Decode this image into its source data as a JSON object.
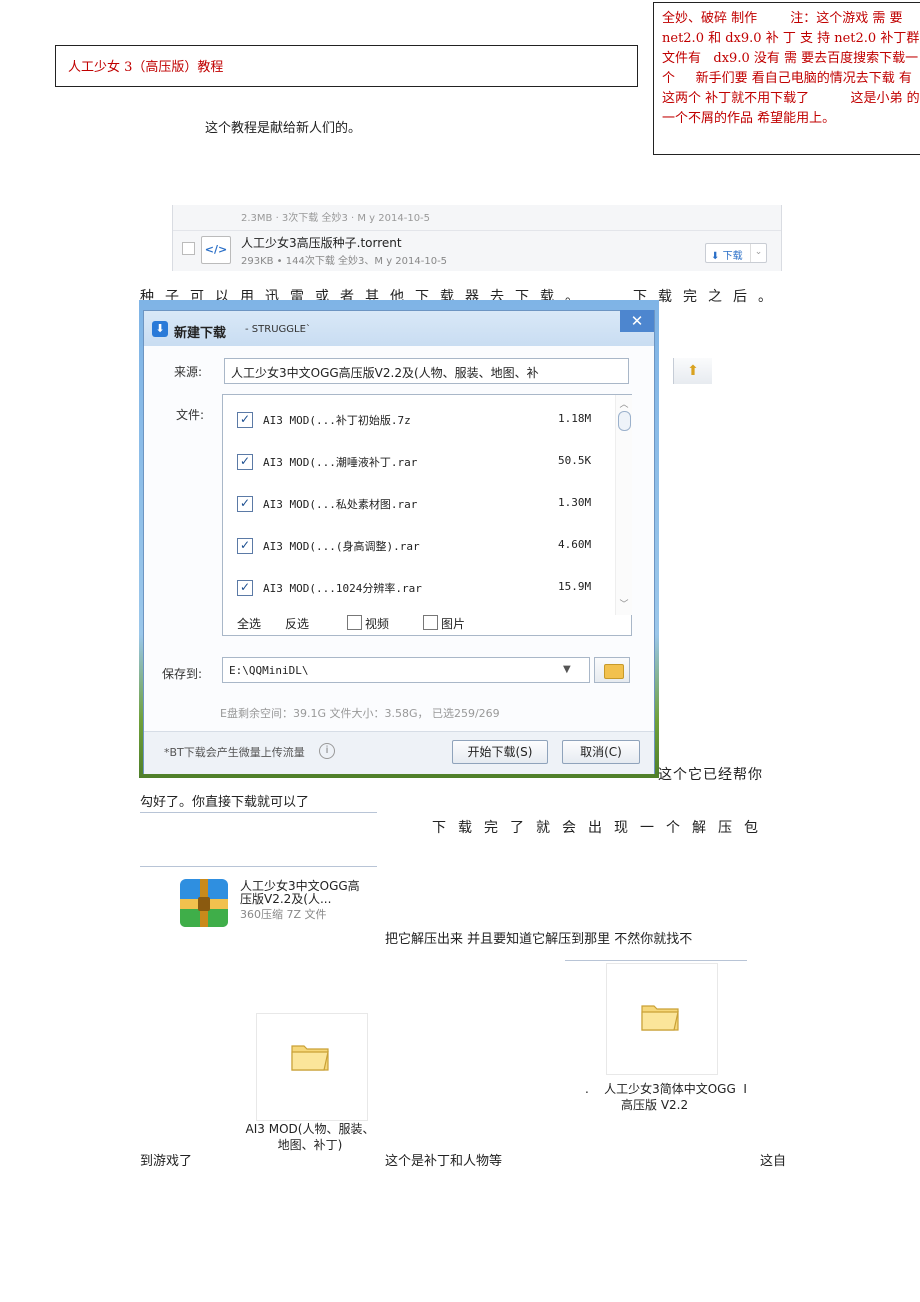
{
  "title": "人工少女 3（高压版）教程",
  "note": "全妙、破碎 制作        注：这个游戏 需 要 net2.0 和 dx9.0 补 丁 支 持 net2.0 补丁群文件有   dx9.0 没有 需 要去百度搜索下载一个     新手们要 看自己电脑的情况去下载 有这两个 补丁就不用下载了          这是小弟 的一个不屑的作品 希望能用上。",
  "intro": "这个教程是献给新人们的。",
  "download_list": {
    "prev_row_text": "2.3MB · 3次下载  全妙3 · M y  2014-10-5",
    "file_name": "人工少女3高压版种子.torrent",
    "file_meta": "293KB • 144次下载  全妙3、M y  2014-10-5",
    "download_button": "下载",
    "icon_text": "</>"
  },
  "paragraph1_a": "种子可以用迅雷或者其他下载器去下载。",
  "paragraph1_b": "下载完之后。",
  "dialog": {
    "title": "新建下载",
    "subtitle": "- STRUGGLE`",
    "close": "✕",
    "source_label": "来源:",
    "source_value": "人工少女3中文OGG高压版V2.2及(人物、服装、地图、补",
    "files_label": "文件:",
    "files": [
      {
        "name": "AI3 MOD(...补丁初始版.7z",
        "size": "1.18M",
        "checked": true
      },
      {
        "name": "AI3 MOD(...潮唾液补丁.rar",
        "size": "50.5K",
        "checked": true
      },
      {
        "name": "AI3 MOD(...私处素材图.rar",
        "size": "1.30M",
        "checked": true
      },
      {
        "name": "AI3 MOD(...(身高调整).rar",
        "size": "4.60M",
        "checked": true
      },
      {
        "name": "AI3 MOD(...1024分辨率.rar",
        "size": "15.9M",
        "checked": true
      }
    ],
    "select_all": "全选",
    "invert": "反选",
    "video": "视频",
    "image": "图片",
    "save_label": "保存到:",
    "save_path": "E:\\QQMiniDL\\",
    "space_info": "E盘剩余空间：39.1G     文件大小：3.58G，     已选259/269",
    "bt_note": "*BT下载会产生微量上传流量",
    "start_button": "开始下载(S)",
    "cancel_button": "取消(C)"
  },
  "paragraph2_a": "这个它已经帮你",
  "paragraph2_b": "勾好了。你直接下载就可以了",
  "paragraph3": "下载完了就会出现一个解压包",
  "archive": {
    "name_line1": "人工少女3中文OGG高",
    "name_line2": "压版V2.2及(人...",
    "type": "360压缩 7Z 文件"
  },
  "paragraph4": "把它解压出来 并且要知道它解压到那里 不然你就找不",
  "folder_game": {
    "line1": "人工少女3简体中文OGG",
    "line2": "高压版 V2.2",
    "prefix": ".",
    "suffix": "I"
  },
  "folder_mod": {
    "line1": "AI3 MOD(人物、服装、",
    "line2": "地图、补丁)"
  },
  "paragraph5_a": "到游戏了",
  "paragraph5_b": "这个是补丁和人物等",
  "paragraph5_c": "这自",
  "colors": {
    "note_red": "#c00000",
    "accent_blue": "#2a7ad8"
  }
}
